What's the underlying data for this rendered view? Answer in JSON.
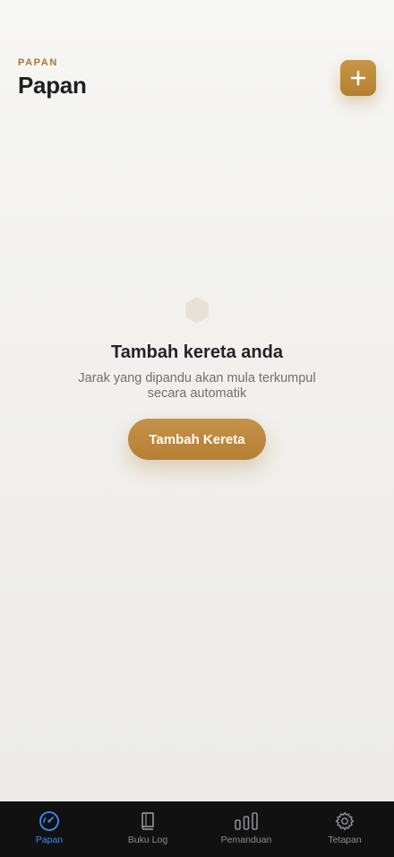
{
  "header": {
    "eyebrow": "PAPAN",
    "title": "Papan",
    "add_icon": "plus-icon"
  },
  "empty_state": {
    "icon": "hexagon-icon",
    "title": "Tambah kereta anda",
    "subtitle": "Jarak yang dipandu akan mula terkumpul secara automatik",
    "button_label": "Tambah Kereta"
  },
  "tabbar": {
    "active_tab": "Papan",
    "items": [
      {
        "label": "Papan",
        "icon": "speedometer-icon",
        "active": true
      },
      {
        "label": "Buku Log",
        "icon": "book-icon",
        "active": false
      },
      {
        "label": "Pemanduan",
        "icon": "bar-chart-icon",
        "active": false
      },
      {
        "label": "Tetapan",
        "icon": "gear-icon",
        "active": false
      }
    ]
  },
  "colors": {
    "accent": "#b8843a",
    "active_tab": "#3d8bf3",
    "tabbar_bg": "#111112",
    "inactive_tab": "#8e8e93"
  }
}
